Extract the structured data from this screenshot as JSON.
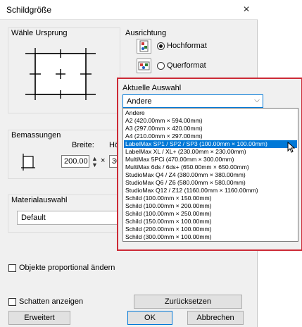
{
  "dialog": {
    "title": "Schildgröße",
    "close_symbol": "×",
    "origin_label": "Wähle Ursprung",
    "orientation_label": "Ausrichtung",
    "portrait_label": "Hochformat",
    "landscape_label": "Querformat",
    "orientation_selected": "Hochformat",
    "dimensions_label": "Bemassungen",
    "width_label": "Breite:",
    "height_label_partial": "Hö",
    "width_value": "200.00",
    "height_value_partial": "30",
    "times_symbol": "×",
    "material_label": "Materialauswahl",
    "material_value": "Default",
    "proportional_label": "Objekte proportional ändern",
    "proportional_checked": false,
    "shadow_label": "Schatten anzeigen",
    "shadow_checked": false,
    "reset_button": "Zurücksetzen",
    "advanced_button": "Erweitert",
    "ok_button": "OK",
    "cancel_button": "Abbrechen"
  },
  "selection": {
    "label": "Aktuelle Auswahl",
    "value": "Andere",
    "highlight_color": "#cc2a36",
    "options": [
      "Andere",
      "A2 (420.00mm × 594.00mm)",
      "A3 (297.00mm × 420.00mm)",
      "A4 (210.00mm × 297.00mm)",
      "LabelMax SP1 / SP2 / SP3 (100.00mm × 100.00mm)",
      "LabelMax XL / XL+ (230.00mm × 230.00mm)",
      "MultiMax 5PCi (470.00mm × 300.00mm)",
      "MultiMax 6ds / 6ds+ (650.00mm × 650.00mm)",
      "StudioMax Q4 / Z4 (380.00mm × 380.00mm)",
      "StudioMax Q6 / Z6 (580.00mm × 580.00mm)",
      "StudioMax Q12 / Z12 (1160.00mm × 1160.00mm)",
      "Schild (100.00mm × 150.00mm)",
      "Schild (100.00mm × 200.00mm)",
      "Schild (100.00mm × 250.00mm)",
      "Schild (150.00mm × 100.00mm)",
      "Schild (200.00mm × 100.00mm)",
      "Schild (300.00mm × 100.00mm)"
    ],
    "selected_index": 4
  },
  "icons": {
    "close": "close-icon",
    "dropdown": "chevron-down-icon",
    "portrait": "portrait-orientation-icon",
    "landscape": "landscape-orientation-icon",
    "origin": "origin-grid-icon",
    "sign": "sign-preview-icon",
    "cursor": "mouse-pointer-icon",
    "spin": "spin-arrows-icon"
  },
  "colors": {
    "accent": "#0078d7",
    "dialog_bg": "#f0f0f0"
  }
}
